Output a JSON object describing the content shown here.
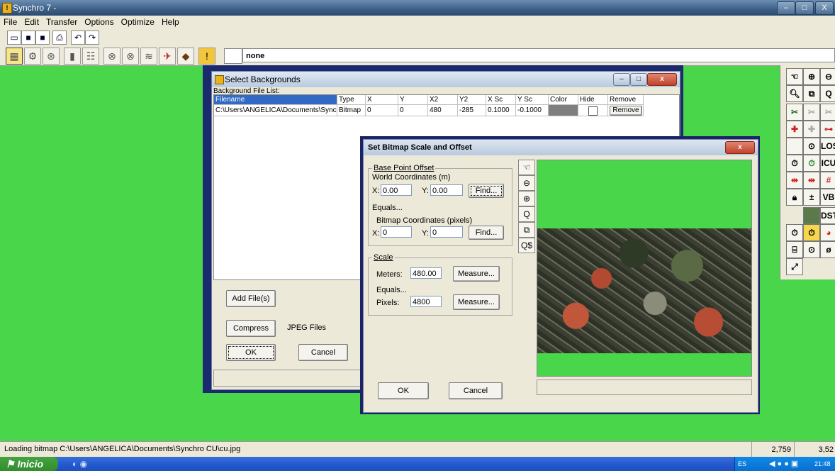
{
  "app": {
    "title": "Synchro 7 -",
    "icon_label": "!",
    "window_buttons": [
      "–",
      "□",
      "X"
    ]
  },
  "menu": [
    "File",
    "Edit",
    "Transfer",
    "Options",
    "Optimize",
    "Help"
  ],
  "toolbar": {
    "zoom_value": "none"
  },
  "palette": {
    "labels": [
      "LOS",
      "ICU",
      "VB",
      "DST",
      "ø"
    ]
  },
  "statusbar": {
    "message": "Loading bitmap C:\\Users\\ANGELICA\\Documents\\Synchro CU\\cu.jpg",
    "coord_x": "2,759",
    "coord_y": "3,52"
  },
  "taskbar": {
    "start_label": "Inicio",
    "language": "ES",
    "time": "21:48"
  },
  "select_backgrounds": {
    "title": "Select Backgrounds",
    "list_label": "Background File List:",
    "columns": [
      "Filename",
      "Type",
      "X",
      "Y",
      "X2",
      "Y2",
      "X Sc",
      "Y Sc",
      "Color",
      "Hide",
      "Remove"
    ],
    "rows": [
      [
        "C:\\Users\\ANGELICA\\Documents\\Synchr",
        "Bitmap",
        "0",
        "0",
        "480",
        "-285",
        "0.1000",
        "-0.1000",
        "",
        "",
        "Remove"
      ]
    ],
    "add_files": "Add File(s)",
    "compress": "Compress",
    "format": "JPEG Files",
    "ok": "OK",
    "cancel": "Cancel",
    "colors": {
      "row_color_swatch": "#7f7f7f",
      "header_selected": "#316ac5"
    }
  },
  "set_bitmap": {
    "title": "Set Bitmap Scale and Offset",
    "base_point_offset": "Base Point Offset",
    "world_coords": "World Coordinates (m)",
    "x_label": "X:",
    "x_world": "0.00",
    "y_label": "Y:",
    "y_world": "0.00",
    "find": "Find...",
    "equals": "Equals...",
    "bitmap_coords": "Bitmap Coordinates (pixels)",
    "x_bitmap": "0",
    "y_bitmap": "0",
    "scale": "Scale",
    "meters_label": "Meters:",
    "meters_value": "480.00",
    "measure": "Measure...",
    "pixels_label": "Pixels:",
    "pixels_value": "4800",
    "ok": "OK",
    "cancel": "Cancel",
    "tools": [
      "hand-icon",
      "zoom-out-icon",
      "zoom-in-icon",
      "zoom-icon",
      "zoom-window-icon",
      "zoom-scale-icon"
    ],
    "colors": {
      "background_green": "#4ad64b"
    }
  }
}
